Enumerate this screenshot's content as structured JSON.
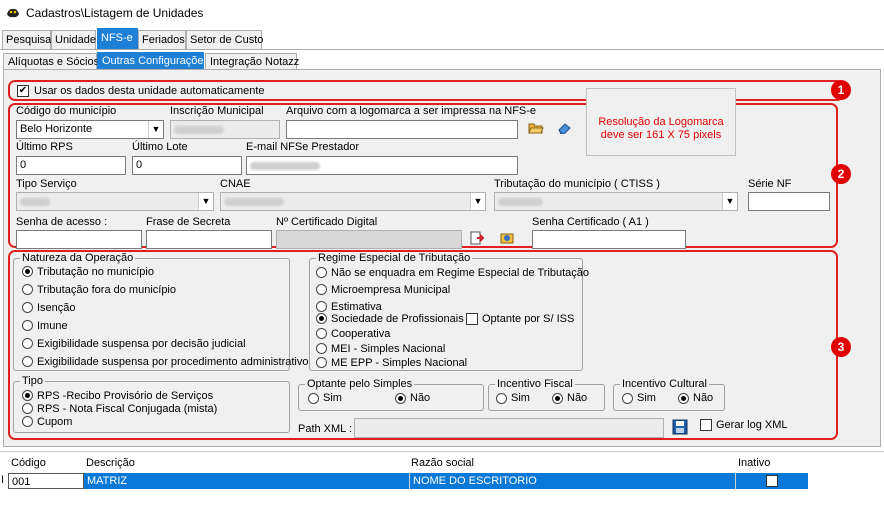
{
  "window": {
    "title": "Cadastros\\Listagem de Unidades"
  },
  "tabs": [
    "Pesquisa",
    "Unidade",
    "NFS-e",
    "Feriados",
    "Setor de Custo"
  ],
  "subtabs": [
    "Alíquotas e Sócios",
    "Outras Configurações",
    "Integração Notazz"
  ],
  "section1": {
    "badge": "1",
    "auto_data_label": "Usar os dados desta unidade automaticamente",
    "auto_data_checked": true
  },
  "section2": {
    "badge": "2",
    "codigo_municipio_label": "Código do município",
    "codigo_municipio_value": "Belo Horizonte",
    "inscricao_municipal_label": "Inscrição Municipal",
    "arquivo_logo_label": "Arquivo com a logomarca a ser impressa na NFS-e",
    "logo_note": "Resolução da Logomarca deve ser 161 X 75 pixels",
    "ultimo_rps_label": "Último RPS",
    "ultimo_rps_value": "0",
    "ultimo_lote_label": "Último Lote",
    "ultimo_lote_value": "0",
    "email_label": "E-mail NFSe Prestador",
    "tipo_servico_label": "Tipo Serviço",
    "cnae_label": "CNAE",
    "tributacao_label": "Tributação do município ( CTISS )",
    "serie_nf_label": "Série NF",
    "senha_acesso_label": "Senha de acesso :",
    "frase_secreta_label": "Frase de Secreta",
    "cert_digital_label": "Nº Certificado Digital",
    "senha_cert_label": "Senha Certificado ( A1 )"
  },
  "section3": {
    "badge": "3",
    "natureza": {
      "title": "Natureza da Operação",
      "options": [
        "Tributação no município",
        "Tributação fora do município",
        "Isenção",
        "Imune",
        "Exigibilidade suspensa por decisão judicial",
        "Exigibilidade suspensa por procedimento administrativo"
      ],
      "selected": 0
    },
    "regime": {
      "title": "Regime Especial de Tributação",
      "options": [
        "Não se enquadra em Regime Especial de Tributação",
        "Microempresa Municipal",
        "Estimativa",
        "Sociedade de Profissionais",
        "Cooperativa",
        "MEI - Simples Nacional",
        "ME EPP - Simples Nacional"
      ],
      "selected": 3,
      "optante_label": "Optante por S/ ISS"
    },
    "tipo": {
      "title": "Tipo",
      "options": [
        "RPS -Recibo Provisório de Serviços",
        "RPS - Nota Fiscal Conjugada (mista)",
        "Cupom"
      ],
      "selected": 0
    },
    "optante_simples": {
      "title": "Optante pelo Simples",
      "sim": "Sim",
      "nao": "Não"
    },
    "incentivo_fiscal": {
      "title": "Incentivo Fiscal",
      "sim": "Sim",
      "nao": "Não"
    },
    "incentivo_cultural": {
      "title": "Incentivo Cultural",
      "sim": "Sim",
      "nao": "Não"
    },
    "path_xml_label": "Path XML :",
    "gerar_log_label": "Gerar log XML"
  },
  "grid": {
    "headers": [
      "Código",
      "Descrição",
      "Razão social",
      "Inativo"
    ],
    "row": {
      "codigo": "001",
      "descricao": "MATRIZ",
      "razao": "NOME DO ESCRITORIO"
    }
  }
}
